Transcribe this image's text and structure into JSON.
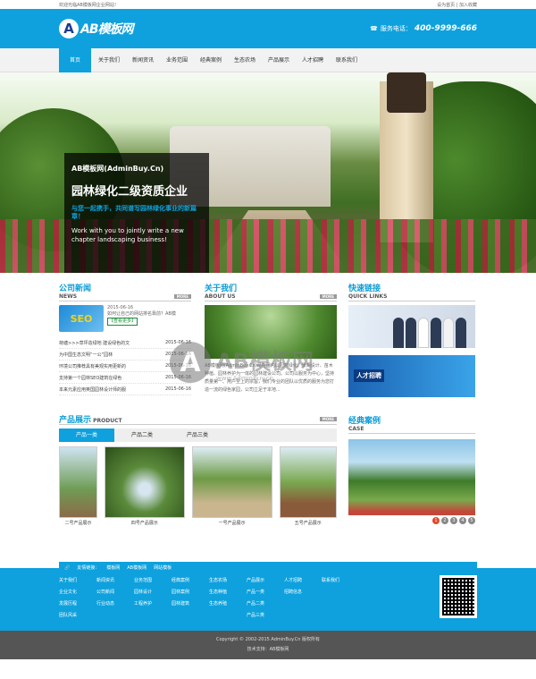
{
  "topbar": {
    "welcome": "欢迎光临AB模板网企业网站！",
    "links": "设为首页 | 加入收藏"
  },
  "header": {
    "logo_mark": "A",
    "logo_text": "AB模板网",
    "hotline_label": "服务电话：",
    "hotline_number": "400-9999-666"
  },
  "nav": {
    "items": [
      "首页",
      "关于我们",
      "新闻资讯",
      "业务范围",
      "经典案例",
      "生态农场",
      "产品展示",
      "人才招聘",
      "联系我们"
    ]
  },
  "banner": {
    "site": "AB模板网(AdminBuy.Cn)",
    "headline": "园林绿化二级资质企业",
    "cn_slogan": "与您一起携手，共同谱写园林绿化事业的新篇章！",
    "en_slogan": "Work with you to jointly write a new chapter landscaping business!"
  },
  "news": {
    "title": "公司新闻",
    "sub": "NEWS",
    "more": "MORE",
    "seo": "SEO",
    "top_date": "2015-06-16",
    "top_title": "如何让自己的网站排名靠前？AB模",
    "top_link": "【查看更多】",
    "items": [
      {
        "title": "荷塘>>>草坪造绿地 建设绿色的文",
        "date": "2015-06-16"
      },
      {
        "title": "为中国生态文明“一公”园林",
        "date": "2015-06-16"
      },
      {
        "title": "环境公司推荐具有美观实用更新的",
        "date": "2015-06-16"
      },
      {
        "title": "支持第一个园林SEO建筑在绿色",
        "date": "2015-06-16"
      },
      {
        "title": "本来元素应用英国园林设计师的服",
        "date": "2015-06-16"
      }
    ]
  },
  "about": {
    "title": "关于我们",
    "sub": "ABOUT US",
    "more": "MORE",
    "text": "AB模板网(AdminBuy.Cn)是在国内以园林绿化、景观设计、苗木种植、园林养护为一体的园林建设公司。公司以服务为中心，坚持质量第一、用户至上的宗旨，我们专业的团队以优质的服务为您打造一流的绿色家园，公司立足于本地..."
  },
  "quick": {
    "title": "快速链接",
    "sub": "QUICK LINKS",
    "recruit": "人才招聘"
  },
  "products": {
    "title": "产品展示",
    "sub": "PRODUCT",
    "more": "MORE",
    "tabs": [
      "产品一类",
      "产品二类",
      "产品三类"
    ],
    "items": [
      "二号产品展示",
      "四号产品展示",
      "一号产品展示",
      "五号产品展示"
    ]
  },
  "cases": {
    "title": "经典案例",
    "sub": "CASE",
    "pages": [
      "1",
      "2",
      "3",
      "4",
      "5"
    ]
  },
  "links": {
    "label": "友情链接：",
    "items": [
      "模板网",
      "AB模板网",
      "网站模板"
    ]
  },
  "footer": {
    "cols": [
      [
        "关于我们",
        "企业文化",
        "发展历程",
        "团队风采"
      ],
      [
        "新闻资讯",
        "公司新闻",
        "行业动态"
      ],
      [
        "业务范围",
        "园林设计",
        "工程养护"
      ],
      [
        "经典案例",
        "园林案例",
        "园林建筑"
      ],
      [
        "生态农场",
        "生态种植",
        "生态养殖"
      ],
      [
        "产品展示",
        "产品一类",
        "产品二类",
        "产品三类"
      ],
      [
        "人才招聘",
        "招聘信息"
      ],
      [
        "联系我们"
      ]
    ],
    "copyright": "Copyright © 2002-2015 AdminBuy.Cn 版权所有",
    "support": "技术支持：AB模板网"
  },
  "watermark": {
    "mark": "A",
    "text": "AB模板网",
    "url": "www.AdminBuy.cn"
  },
  "colors": {
    "accent": "#0ea1dd",
    "dark_footer": "#555555"
  }
}
